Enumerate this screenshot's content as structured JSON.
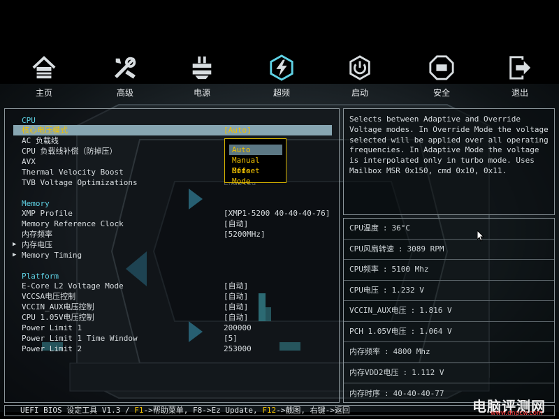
{
  "nav": [
    {
      "label": "主页",
      "icon": "home-icon"
    },
    {
      "label": "高级",
      "icon": "tools-icon"
    },
    {
      "label": "电源",
      "icon": "power-supply-icon"
    },
    {
      "label": "超频",
      "icon": "overclock-icon"
    },
    {
      "label": "启动",
      "icon": "boot-power-icon"
    },
    {
      "label": "安全",
      "icon": "security-icon"
    },
    {
      "label": "退出",
      "icon": "exit-icon"
    }
  ],
  "settings": {
    "cpu_section": "CPU",
    "core_voltage_mode": {
      "label": "核心电压模式",
      "value": "[Auto]"
    },
    "ac_loadline": {
      "label": "AC 负载线"
    },
    "cpu_llc": {
      "label": "CPU 负载线补偿（防掉压）"
    },
    "avx": {
      "label": "AVX"
    },
    "tvb": {
      "label": "Thermal Velocity Boost"
    },
    "tvb_opt": {
      "label": "TVB Voltage Optimizations",
      "value": "Enabled"
    },
    "memory_section": "Memory",
    "xmp": {
      "label": "XMP Profile",
      "value": "[XMP1-5200 40-40-40-76]"
    },
    "mem_ref_clock": {
      "label": "Memory Reference Clock",
      "value": "[自动]"
    },
    "mem_freq": {
      "label": "内存频率",
      "value": "[5200MHz]"
    },
    "mem_voltage": {
      "label": "内存电压"
    },
    "mem_timing": {
      "label": "Memory Timing"
    },
    "platform_section": "Platform",
    "ecore_l2": {
      "label": "E-Core L2 Voltage Mode",
      "value": "[自动]"
    },
    "vccsa": {
      "label": "VCCSA电压控制",
      "value": "[自动]"
    },
    "vccin_aux": {
      "label": "VCCIN_AUX电压控制",
      "value": "[自动]"
    },
    "cpu_105v": {
      "label": "CPU 1.05V电压控制",
      "value": "[自动]"
    },
    "power_limit_1": {
      "label": "Power Limit 1",
      "value": "200000"
    },
    "power_limit_1_tw": {
      "label": "Power Limit 1 Time Window",
      "value": "[5]"
    },
    "power_limit_2": {
      "label": "Power Limit 2",
      "value": "253000"
    }
  },
  "dropdown": {
    "options": [
      "Auto",
      "Manual Mode",
      "Offset Mode"
    ],
    "selected": "Auto"
  },
  "help": {
    "text": "Selects between Adaptive and Override\nVoltage modes. In Override Mode the voltage\nselected will be applied over all operating\nfrequencies. In Adaptive Mode the voltage\nis interpolated only in turbo mode. Uses\nMailbox MSR 0x150, cmd 0x10, 0x11."
  },
  "monitor": [
    {
      "label": "CPU温度",
      "value": "36°C"
    },
    {
      "label": "CPU风扇转速",
      "value": "3089 RPM"
    },
    {
      "label": "CPU频率",
      "value": "5100 Mhz"
    },
    {
      "label": "CPU电压",
      "value": "1.232 V"
    },
    {
      "label": "VCCIN_AUX电压",
      "value": "1.816 V"
    },
    {
      "label": "PCH 1.05V电压",
      "value": "1.064 V"
    },
    {
      "label": "内存频率",
      "value": "4800 Mhz"
    },
    {
      "label": "内存VDD2电压",
      "value": "1.112 V"
    },
    {
      "label": "内存时序",
      "value": "40-40-40-77"
    }
  ],
  "footer": {
    "prefix": "UEFI BIOS 设定工具 V1.3 / ",
    "f1_key": "F1",
    "f1_text": "->帮助菜单, F8->Ez Update, ",
    "f12_key": "F12",
    "f12_text": "->截图, 右键->返回"
  },
  "watermark": {
    "text": "电脑评测网",
    "url": "www.dnpcw.com"
  },
  "colors": {
    "accent": "#5fd3e6",
    "highlight_text": "#f2c200",
    "highlight_bar": "#87a6b2"
  }
}
